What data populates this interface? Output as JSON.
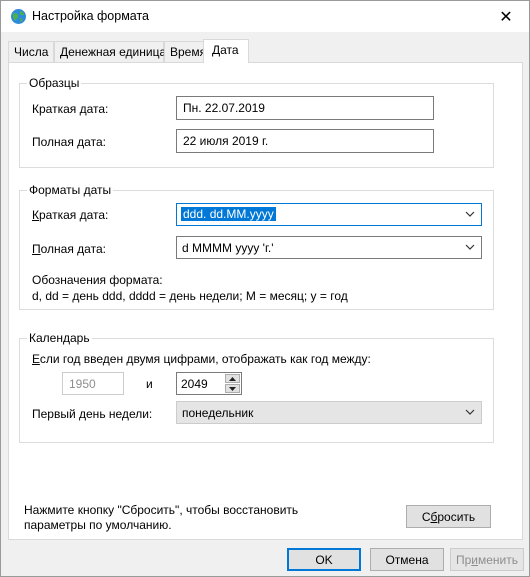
{
  "window": {
    "title": "Настройка формата",
    "close_glyph": "✕"
  },
  "tabs": [
    {
      "label": "Числа"
    },
    {
      "label": "Денежная единица"
    },
    {
      "label": "Время"
    },
    {
      "label": "Дата"
    }
  ],
  "samples": {
    "title": "Образцы",
    "short_label": "Краткая дата:",
    "short_value": "Пн. 22.07.2019",
    "long_label": "Полная дата:",
    "long_value": "22 июля 2019 г."
  },
  "formats": {
    "title": "Форматы даты",
    "short_label_first": "К",
    "short_label_rest": "раткая дата:",
    "short_value": "ddd. dd.MM.yyyy",
    "long_label_first": "П",
    "long_label_rest": "олная дата:",
    "long_value": "d MMMM yyyy 'г.'",
    "notation_line1": "Обозначения формата:",
    "notation_line2": "d, dd = день  ddd, dddd = день недели; M = месяц; y = год"
  },
  "calendar": {
    "title": "Календарь",
    "twodigit_label_first": "Е",
    "twodigit_label_rest": "сли год введен двумя цифрами, отображать как год между:",
    "from_year": "1950",
    "and_label": "и",
    "to_year": "2049",
    "firstday_label": "Первый день недели:",
    "firstday_value": "понедельник"
  },
  "reset": {
    "hint_line1": "Нажмите кнопку \"Сбросить\", чтобы восстановить",
    "hint_line2": "параметры по умолчанию.",
    "button_first": "С",
    "button_mid": "б",
    "button_rest": "росить"
  },
  "footer": {
    "ok_label": "OK",
    "cancel_label": "Отмена",
    "apply_first": "Пр",
    "apply_mid": "и",
    "apply_rest": "менить"
  },
  "colors": {
    "accent": "#0078d7",
    "disabled_text": "#8d8d8d"
  }
}
